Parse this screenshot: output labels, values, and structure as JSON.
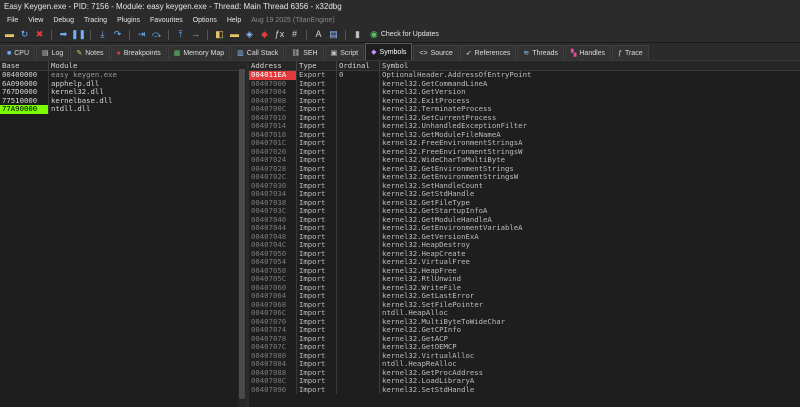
{
  "window": {
    "title": "Easy Keygen.exe - PID: 7156 - Module: easy keygen.exe - Thread: Main Thread 6356 - x32dbg"
  },
  "menu": {
    "items": [
      "File",
      "View",
      "Debug",
      "Tracing",
      "Plugins",
      "Favourites",
      "Options",
      "Help"
    ],
    "date": "Aug 19 2025 (TitanEngine)"
  },
  "toolbar": {
    "updates_label": "Check for Updates"
  },
  "tabs": [
    {
      "label": "CPU",
      "icon": "cpu-icon",
      "glyph": "■",
      "color": "#6fb3ff"
    },
    {
      "label": "Log",
      "icon": "log-icon",
      "glyph": "▤",
      "color": "#cfcfcf"
    },
    {
      "label": "Notes",
      "icon": "notes-icon",
      "glyph": "✎",
      "color": "#e8c36a"
    },
    {
      "label": "Breakpoints",
      "icon": "breakpoints-icon",
      "glyph": "●",
      "color": "#e33b3b"
    },
    {
      "label": "Memory Map",
      "icon": "memory-map-icon",
      "glyph": "▦",
      "color": "#59c36a"
    },
    {
      "label": "Call Stack",
      "icon": "call-stack-icon",
      "glyph": "▥",
      "color": "#8fbcff"
    },
    {
      "label": "SEH",
      "icon": "seh-icon",
      "glyph": "⛓",
      "color": "#c9c9c9"
    },
    {
      "label": "Script",
      "icon": "script-icon",
      "glyph": "▣",
      "color": "#c9c9c9"
    },
    {
      "label": "Symbols",
      "icon": "symbols-icon",
      "glyph": "◆",
      "color": "#c98bff"
    },
    {
      "label": "Source",
      "icon": "source-icon",
      "glyph": "<>",
      "color": "#d4d4d4"
    },
    {
      "label": "References",
      "icon": "references-icon",
      "glyph": "➶",
      "color": "#d4d4d4"
    },
    {
      "label": "Threads",
      "icon": "threads-icon",
      "glyph": "≋",
      "color": "#8fbcff"
    },
    {
      "label": "Handles",
      "icon": "handles-icon",
      "glyph": "▚",
      "color": "#e34c9a"
    },
    {
      "label": "Trace",
      "icon": "trace-icon",
      "glyph": "ƒ",
      "color": "#d4d4d4"
    }
  ],
  "active_tab": "Symbols",
  "modules": {
    "headers": [
      "Base",
      "Module"
    ],
    "rows": [
      [
        "00400000",
        "easy keygen.exe"
      ],
      [
        "6A090000",
        "apphelp.dll"
      ],
      [
        "767D0000",
        "kernel32.dll"
      ],
      [
        "77510000",
        "kernelbase.dll"
      ],
      [
        "77A90000",
        "ntdll.dll"
      ]
    ]
  },
  "symbols": {
    "headers": [
      "Address",
      "Type",
      "Ordinal",
      "Symbol"
    ],
    "rows": [
      [
        "004011EA",
        "Export",
        "0",
        "OptionalHeader.AddressOfEntryPoint"
      ],
      [
        "00407000",
        "Import",
        "",
        "kernel32.GetCommandLineA"
      ],
      [
        "00407004",
        "Import",
        "",
        "kernel32.GetVersion"
      ],
      [
        "00407008",
        "Import",
        "",
        "kernel32.ExitProcess"
      ],
      [
        "0040700C",
        "Import",
        "",
        "kernel32.TerminateProcess"
      ],
      [
        "00407010",
        "Import",
        "",
        "kernel32.GetCurrentProcess"
      ],
      [
        "00407014",
        "Import",
        "",
        "kernel32.UnhandledExceptionFilter"
      ],
      [
        "00407018",
        "Import",
        "",
        "kernel32.GetModuleFileNameA"
      ],
      [
        "0040701C",
        "Import",
        "",
        "kernel32.FreeEnvironmentStringsA"
      ],
      [
        "00407020",
        "Import",
        "",
        "kernel32.FreeEnvironmentStringsW"
      ],
      [
        "00407024",
        "Import",
        "",
        "kernel32.WideCharToMultiByte"
      ],
      [
        "00407028",
        "Import",
        "",
        "kernel32.GetEnvironmentStrings"
      ],
      [
        "0040702C",
        "Import",
        "",
        "kernel32.GetEnvironmentStringsW"
      ],
      [
        "00407030",
        "Import",
        "",
        "kernel32.SetHandleCount"
      ],
      [
        "00407034",
        "Import",
        "",
        "kernel32.GetStdHandle"
      ],
      [
        "00407038",
        "Import",
        "",
        "kernel32.GetFileType"
      ],
      [
        "0040703C",
        "Import",
        "",
        "kernel32.GetStartupInfoA"
      ],
      [
        "00407040",
        "Import",
        "",
        "kernel32.GetModuleHandleA"
      ],
      [
        "00407044",
        "Import",
        "",
        "kernel32.GetEnvironmentVariableA"
      ],
      [
        "00407048",
        "Import",
        "",
        "kernel32.GetVersionExA"
      ],
      [
        "0040704C",
        "Import",
        "",
        "kernel32.HeapDestroy"
      ],
      [
        "00407050",
        "Import",
        "",
        "kernel32.HeapCreate"
      ],
      [
        "00407054",
        "Import",
        "",
        "kernel32.VirtualFree"
      ],
      [
        "00407058",
        "Import",
        "",
        "kernel32.HeapFree"
      ],
      [
        "0040705C",
        "Import",
        "",
        "kernel32.RtlUnwind"
      ],
      [
        "00407060",
        "Import",
        "",
        "kernel32.WriteFile"
      ],
      [
        "00407064",
        "Import",
        "",
        "kernel32.GetLastError"
      ],
      [
        "00407068",
        "Import",
        "",
        "kernel32.SetFilePointer"
      ],
      [
        "0040706C",
        "Import",
        "",
        "ntdll.HeapAlloc"
      ],
      [
        "00407070",
        "Import",
        "",
        "kernel32.MultiByteToWideChar"
      ],
      [
        "00407074",
        "Import",
        "",
        "kernel32.GetCPInfo"
      ],
      [
        "00407078",
        "Import",
        "",
        "kernel32.GetACP"
      ],
      [
        "0040707C",
        "Import",
        "",
        "kernel32.GetOEMCP"
      ],
      [
        "00407080",
        "Import",
        "",
        "kernel32.VirtualAlloc"
      ],
      [
        "00407084",
        "Import",
        "",
        "ntdll.HeapReAlloc"
      ],
      [
        "00407088",
        "Import",
        "",
        "kernel32.GetProcAddress"
      ],
      [
        "0040708C",
        "Import",
        "",
        "kernel32.LoadLibraryA"
      ],
      [
        "00407090",
        "Import",
        "",
        "kernel32.SetStdHandle"
      ]
    ]
  },
  "colors": {
    "accent_green": "#7cfc00",
    "accent_red": "#e33b3b",
    "background": "#1e1e1e"
  }
}
